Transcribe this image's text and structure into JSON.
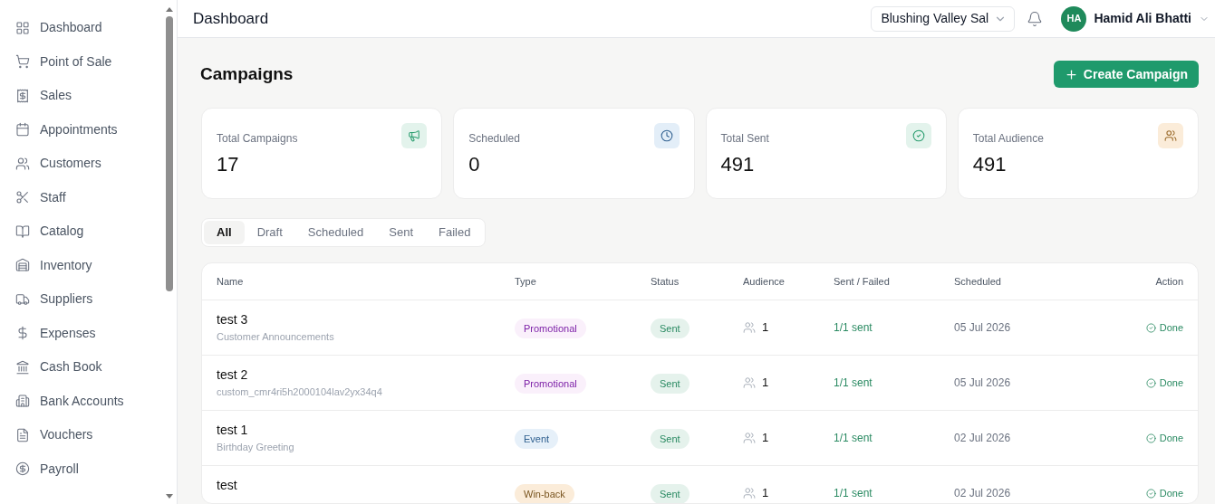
{
  "sidebar": {
    "items": [
      {
        "label": "Dashboard"
      },
      {
        "label": "Point of Sale"
      },
      {
        "label": "Sales"
      },
      {
        "label": "Appointments"
      },
      {
        "label": "Customers"
      },
      {
        "label": "Staff"
      },
      {
        "label": "Catalog"
      },
      {
        "label": "Inventory"
      },
      {
        "label": "Suppliers"
      },
      {
        "label": "Expenses"
      },
      {
        "label": "Cash Book"
      },
      {
        "label": "Bank Accounts"
      },
      {
        "label": "Vouchers"
      },
      {
        "label": "Payroll"
      }
    ]
  },
  "header": {
    "title": "Dashboard",
    "branch": "Blushing Valley Sal",
    "user": {
      "initials": "HA",
      "name": "Hamid Ali Bhatti"
    }
  },
  "page": {
    "title": "Campaigns",
    "create_button": "Create Campaign"
  },
  "stats": [
    {
      "label": "Total Campaigns",
      "value": "17",
      "kind": "megaphone"
    },
    {
      "label": "Scheduled",
      "value": "0",
      "kind": "clock"
    },
    {
      "label": "Total Sent",
      "value": "491",
      "kind": "check"
    },
    {
      "label": "Total Audience",
      "value": "491",
      "kind": "users"
    }
  ],
  "tabs": [
    {
      "label": "All",
      "selected": true
    },
    {
      "label": "Draft",
      "selected": false
    },
    {
      "label": "Scheduled",
      "selected": false
    },
    {
      "label": "Sent",
      "selected": false
    },
    {
      "label": "Failed",
      "selected": false
    }
  ],
  "table": {
    "columns": [
      "Name",
      "Type",
      "Status",
      "Audience",
      "Sent / Failed",
      "Scheduled",
      "Action"
    ],
    "rows": [
      {
        "name": "test 3",
        "template": "Customer Announcements",
        "type": {
          "label": "Promotional",
          "kind": "promotional"
        },
        "status": "Sent",
        "audience": "1",
        "sent_failed": "1/1 sent",
        "scheduled": "05 Jul 2026",
        "action": "Done"
      },
      {
        "name": "test 2",
        "template": "custom_cmr4ri5h2000104lav2yx34q4",
        "type": {
          "label": "Promotional",
          "kind": "promotional"
        },
        "status": "Sent",
        "audience": "1",
        "sent_failed": "1/1 sent",
        "scheduled": "05 Jul 2026",
        "action": "Done"
      },
      {
        "name": "test 1",
        "template": "Birthday Greeting",
        "type": {
          "label": "Event",
          "kind": "event"
        },
        "status": "Sent",
        "audience": "1",
        "sent_failed": "1/1 sent",
        "scheduled": "02 Jul 2026",
        "action": "Done"
      },
      {
        "name": "test",
        "type": {
          "label": "Win-back",
          "kind": "winback"
        },
        "status": "Sent",
        "audience": "1",
        "sent_failed": "1/1 sent",
        "scheduled": "02 Jul 2026",
        "action": "Done"
      }
    ]
  }
}
